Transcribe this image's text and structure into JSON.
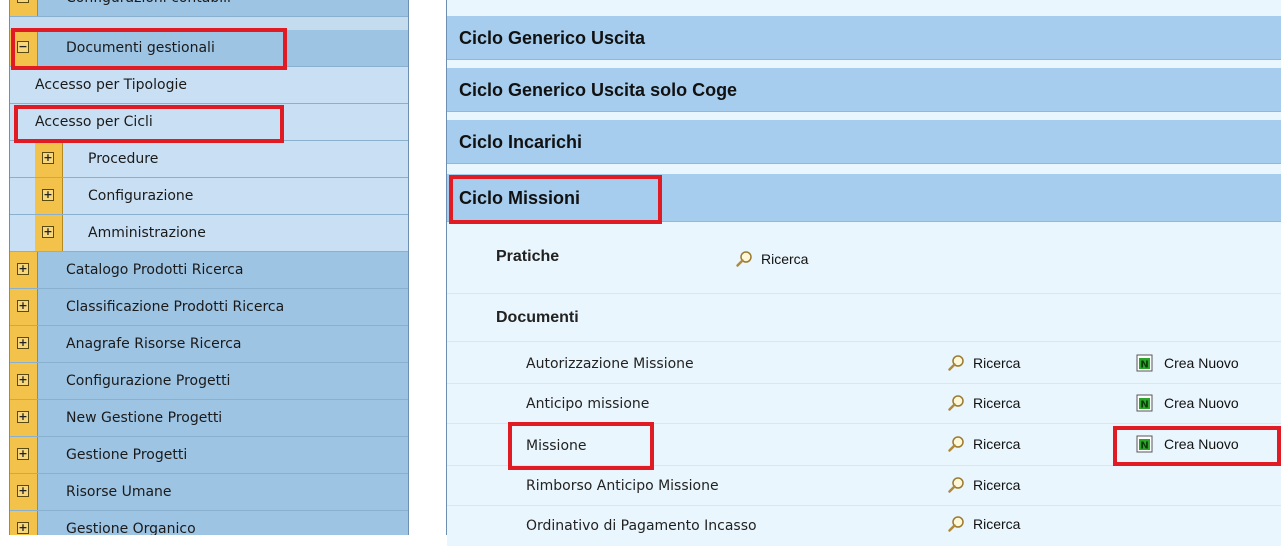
{
  "sidebar": {
    "items": [
      {
        "label": "Configurazioni contabili",
        "toggle": "+"
      },
      {
        "label": "Documenti gestionali",
        "toggle": "−"
      },
      {
        "label": "Accesso per Tipologie"
      },
      {
        "label": "Accesso per Cicli"
      },
      {
        "label": "Procedure",
        "toggle": "+"
      },
      {
        "label": "Configurazione",
        "toggle": "+"
      },
      {
        "label": "Amministrazione",
        "toggle": "+"
      },
      {
        "label": "Catalogo Prodotti Ricerca",
        "toggle": "+"
      },
      {
        "label": "Classificazione Prodotti Ricerca",
        "toggle": "+"
      },
      {
        "label": "Anagrafe Risorse Ricerca",
        "toggle": "+"
      },
      {
        "label": "Configurazione Progetti",
        "toggle": "+"
      },
      {
        "label": "New Gestione Progetti",
        "toggle": "+"
      },
      {
        "label": "Gestione Progetti",
        "toggle": "+"
      },
      {
        "label": "Risorse Umane",
        "toggle": "+"
      },
      {
        "label": "Gestione Organico",
        "toggle": "+"
      }
    ]
  },
  "main": {
    "cycles": [
      {
        "label": "Ciclo Generico Uscita"
      },
      {
        "label": "Ciclo Generico Uscita solo Coge"
      },
      {
        "label": "Ciclo Incarichi"
      },
      {
        "label": "Ciclo Missioni"
      }
    ],
    "pratiche": {
      "label": "Pratiche",
      "search": "Ricerca"
    },
    "documenti": {
      "label": "Documenti"
    },
    "docs": [
      {
        "label": "Autorizzazione Missione",
        "search": "Ricerca",
        "create": "Crea Nuovo"
      },
      {
        "label": "Anticipo missione",
        "search": "Ricerca",
        "create": "Crea Nuovo"
      },
      {
        "label": "Missione",
        "search": "Ricerca",
        "create": "Crea Nuovo"
      },
      {
        "label": "Rimborso Anticipo Missione",
        "search": "Ricerca"
      },
      {
        "label": "Ordinativo di Pagamento Incasso",
        "search": "Ricerca"
      }
    ]
  },
  "colors": {
    "highlight": "#e01b24",
    "toggle": "#f3c24a",
    "cycle_header": "#a6cdee"
  },
  "icons": {
    "search": "magnifier-icon",
    "create": "new-document-icon",
    "expand": "plus-icon",
    "collapse": "minus-icon"
  }
}
